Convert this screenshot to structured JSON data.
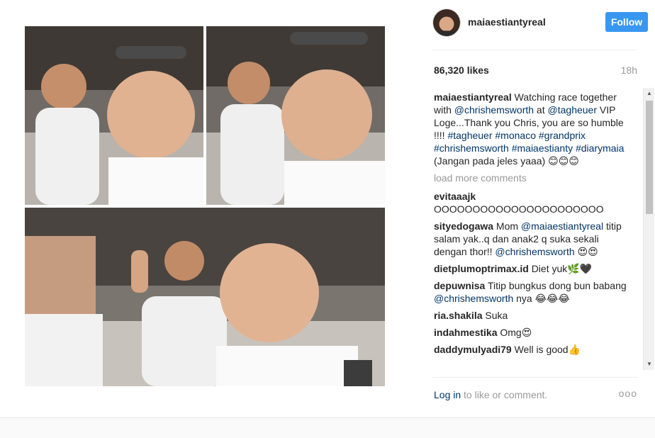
{
  "header": {
    "username": "maiaestiantyreal",
    "follow_label": "Follow"
  },
  "stats": {
    "likes": "86,320 likes",
    "time": "18h"
  },
  "caption": {
    "user": "maiaestiantyreal",
    "text_1": "Watching race together with ",
    "mention_1": "@chrishemsworth",
    "text_2": " at ",
    "mention_2": "@tagheuer",
    "text_3": " VIP Loge...Thank you Chris, you are so humble !!!!",
    "hashtags": "#tagheuer #monaco #grandprix #chrishemsworth #maiaestianty #diarymaia",
    "text_4": " (Jangan pada jeles yaaa) 😊😊😊"
  },
  "load_more": "load more comments",
  "comments": [
    {
      "user": "evitaaajk",
      "text": "OOOOOOOOOOOOOOOOOOOOOO"
    },
    {
      "user": "sityedogawa",
      "text_a": "Mom ",
      "mention": "@maiaestiantyreal",
      "text_b": " titip salam yak..q dan anak2 q suka sekali dengan thor!! ",
      "mention_b": "@chrishemsworth",
      "text_c": " 😍😍"
    },
    {
      "user": "dietplumoptrimax.id",
      "text": "Diet yuk🌿🖤"
    },
    {
      "user": "depuwnisa",
      "text_a": "Titip bungkus dong bun babang ",
      "mention": "@chrishemsworth",
      "text_b": " nya 😂😂😂"
    },
    {
      "user": "ria.shakila",
      "text": "Suka"
    },
    {
      "user": "indahmestika",
      "text": "Omg😍"
    },
    {
      "user": "daddymulyadi79",
      "text": "Well is good👍"
    }
  ],
  "footer": {
    "login_link": "Log in",
    "login_rest": " to like or comment.",
    "more": "ooo"
  },
  "scroll": {
    "up": "▲",
    "down": "▼"
  },
  "colors": {
    "follow_bg": "#3897f0",
    "mention": "#003569",
    "muted": "#999999"
  }
}
